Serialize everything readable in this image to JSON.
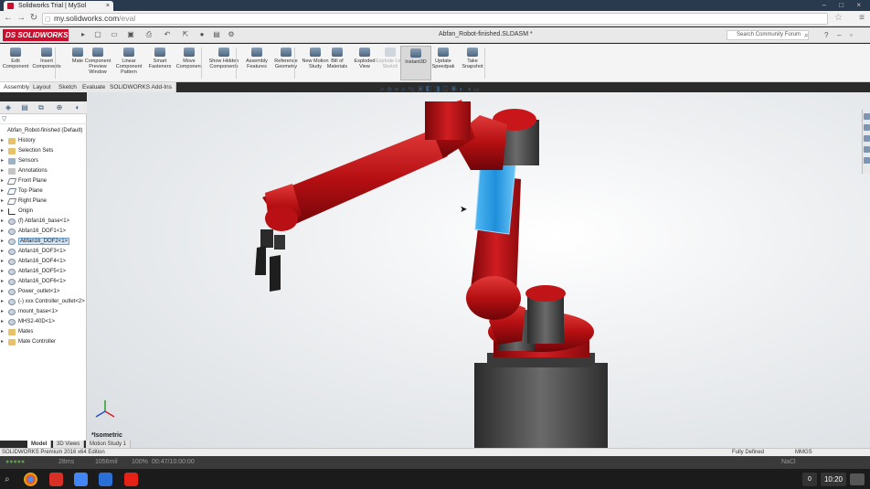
{
  "browser": {
    "tab_title": "Solidworks Trial | MySol",
    "tab_close": "×",
    "url_host": "my.solidworks.com",
    "url_path": "/eval",
    "window_controls": "– □ ×",
    "back_icon": "back-arrow-icon",
    "forward_icon": "forward-arrow-icon",
    "reload_icon": "reload-icon"
  },
  "solidworks": {
    "logo": "DS SOLIDWORKS",
    "document_title": "Abfan_Robot-finished.SLDASM *",
    "search_placeholder": "Search Community Forum",
    "help": "?",
    "pin": "⊞"
  },
  "ribbon": {
    "buttons": [
      {
        "label": "Edit Component",
        "state": "normal"
      },
      {
        "label": "Insert Components",
        "state": "normal"
      },
      {
        "label": "Mate",
        "state": "normal"
      },
      {
        "label": "Component Preview Window",
        "state": "normal"
      },
      {
        "label": "Linear Component Pattern",
        "state": "normal"
      },
      {
        "label": "Smart Fasteners",
        "state": "normal"
      },
      {
        "label": "Move Component",
        "state": "normal"
      },
      {
        "label": "Show Hidden Components",
        "state": "normal"
      },
      {
        "label": "Assembly Features",
        "state": "normal"
      },
      {
        "label": "Reference Geometry",
        "state": "normal"
      },
      {
        "label": "New Motion Study",
        "state": "normal"
      },
      {
        "label": "Bill of Materials",
        "state": "normal"
      },
      {
        "label": "Exploded View",
        "state": "normal"
      },
      {
        "label": "Explode Line Sketch",
        "state": "disabled"
      },
      {
        "label": "Instant3D",
        "state": "active"
      },
      {
        "label": "Update Speedpak",
        "state": "normal"
      },
      {
        "label": "Take Snapshot",
        "state": "normal"
      }
    ]
  },
  "command_tabs": [
    "Assembly",
    "Layout",
    "Sketch",
    "Evaluate",
    "SOLIDWORKS Add-Ins"
  ],
  "feature_tree": {
    "root": "Abfan_Robot-finished  (Default)",
    "items": [
      {
        "label": "History",
        "icon": "folder"
      },
      {
        "label": "Selection Sets",
        "icon": "folder"
      },
      {
        "label": "Sensors",
        "icon": "sensor"
      },
      {
        "label": "Annotations",
        "icon": "annot"
      },
      {
        "label": "Front Plane",
        "icon": "plane"
      },
      {
        "label": "Top Plane",
        "icon": "plane"
      },
      {
        "label": "Right Plane",
        "icon": "plane"
      },
      {
        "label": "Origin",
        "icon": "origin"
      },
      {
        "label": "(f) Abfan16_base<1>",
        "icon": "part"
      },
      {
        "label": "Abfan16_DOF1<1>",
        "icon": "part"
      },
      {
        "label": "Abfan16_DOF2<1>",
        "icon": "part",
        "selected": true
      },
      {
        "label": "Abfan16_DOF3<1>",
        "icon": "part"
      },
      {
        "label": "Abfan16_DOF4<1>",
        "icon": "part"
      },
      {
        "label": "Abfan16_DOF5<1>",
        "icon": "part"
      },
      {
        "label": "Abfan16_DOF6<1>",
        "icon": "part"
      },
      {
        "label": "Power_outlet<1>",
        "icon": "part"
      },
      {
        "label": "(-) xxx Controller_outlet<2>",
        "icon": "part"
      },
      {
        "label": "mount_base<1>",
        "icon": "part"
      },
      {
        "label": "MHS2-40D<1>",
        "icon": "part"
      },
      {
        "label": "Mates",
        "icon": "folder"
      },
      {
        "label": "Mate Controller",
        "icon": "folder"
      }
    ]
  },
  "viewport": {
    "view_label": "*Isometric"
  },
  "bottom_tabs": [
    "Model",
    "3D Views",
    "Motion Study 1"
  ],
  "status": {
    "edition": "SOLIDWORKS Premium 2016 x64 Edition",
    "state": "Fully Defined",
    "units": "MMGS"
  },
  "perf": {
    "latency": "28ms",
    "bandwidth": "1056mil",
    "quality": "100%",
    "timer": "00:47/10:00:00",
    "right_text": "NaCl"
  },
  "taskbar": {
    "notifications": "0",
    "clock": "10:20"
  }
}
